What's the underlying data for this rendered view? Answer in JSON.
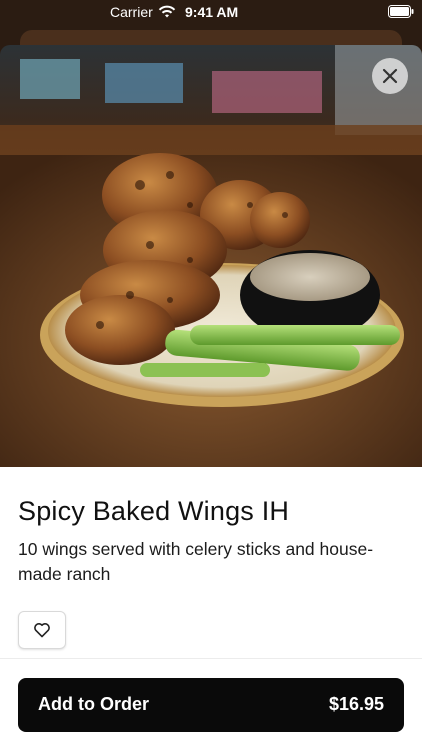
{
  "status_bar": {
    "carrier": "Carrier",
    "time": "9:41 AM",
    "wifi_icon": "wifi-icon",
    "battery_icon": "battery-icon"
  },
  "item": {
    "title": "Spicy Baked Wings IH",
    "description": "10 wings served with celery sticks and house-made ranch"
  },
  "actions": {
    "close_icon": "close-icon",
    "favorite_icon": "heart-icon",
    "order_label": "Add to Order",
    "order_price": "$16.95"
  },
  "colors": {
    "order_button_bg": "#0a0a0a",
    "order_button_text": "#ffffff",
    "panel_bg": "#ffffff"
  }
}
